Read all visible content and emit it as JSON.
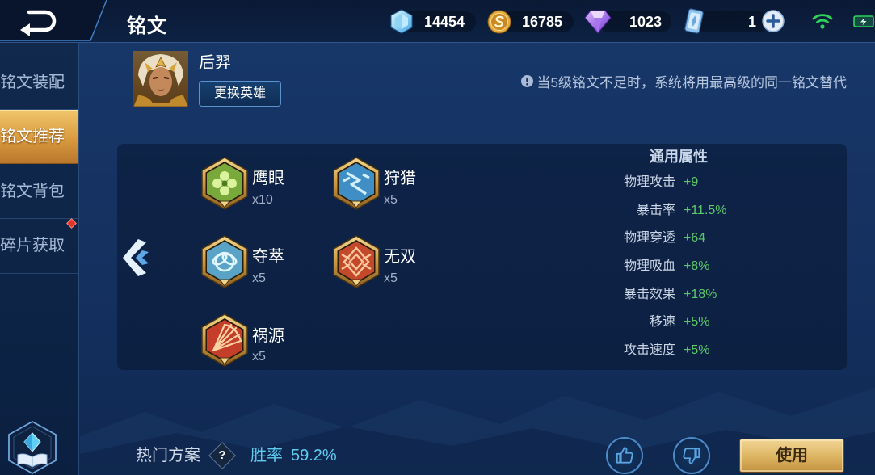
{
  "header": {
    "title": "铭文",
    "back_icon": "back-arrow-icon"
  },
  "currencies": [
    {
      "icon": "diamond-icon",
      "value": "14454"
    },
    {
      "icon": "gold-coin-icon",
      "value": "16785"
    },
    {
      "icon": "purple-gem-icon",
      "value": "1023"
    },
    {
      "icon": "ticket-card-icon",
      "value": "1",
      "add_icon": "plus-icon"
    }
  ],
  "status": {
    "wifi_icon": "wifi-icon",
    "battery_icon": "battery-icon"
  },
  "sidebar": {
    "items": [
      {
        "label": "铭文装配",
        "selected": false
      },
      {
        "label": "铭文推荐",
        "selected": true
      },
      {
        "label": "铭文背包",
        "selected": false
      },
      {
        "label": "碎片获取",
        "selected": false,
        "badge": true
      }
    ],
    "bottom_icon": "inscription-book-icon"
  },
  "hero": {
    "name": "后羿",
    "change_button": "更换英雄",
    "avatar_icon": "hero-portrait-icon"
  },
  "notice": {
    "icon": "info-icon",
    "text": "当5级铭文不足时，系统将用最高级的同一铭文替代"
  },
  "inscriptions": [
    {
      "name": "鹰眼",
      "count": "x10",
      "color": "#79a93a",
      "accent": "#dbf39c"
    },
    {
      "name": "狩猎",
      "count": "x5",
      "color": "#3f8fc6",
      "accent": "#d4f0ff"
    },
    {
      "name": "夺萃",
      "count": "x5",
      "color": "#58a3c6",
      "accent": "#e2f6ff"
    },
    {
      "name": "无双",
      "count": "x5",
      "color": "#c4492b",
      "accent": "#ffc79c"
    },
    {
      "name": "祸源",
      "count": "x5",
      "color": "#c53e2a",
      "accent": "#ffd2a2"
    }
  ],
  "attributes": {
    "title": "通用属性",
    "items": [
      {
        "label": "物理攻击",
        "value": "+9"
      },
      {
        "label": "暴击率",
        "value": "+11.5%"
      },
      {
        "label": "物理穿透",
        "value": "+64"
      },
      {
        "label": "物理吸血",
        "value": "+8%"
      },
      {
        "label": "暴击效果",
        "value": "+18%"
      },
      {
        "label": "移速",
        "value": "+5%"
      },
      {
        "label": "攻击速度",
        "value": "+5%"
      }
    ]
  },
  "footer": {
    "hot_label": "热门方案",
    "help": "?",
    "winrate_label": "胜率",
    "winrate_value": "59.2%",
    "like_icon": "thumbs-up-icon",
    "dislike_icon": "thumbs-down-icon",
    "use_button": "使用"
  },
  "colors": {
    "accent_gold": "#d9ad5a",
    "attribute_value": "#5cc96a",
    "winrate": "#5ecbef",
    "selected_tab": "#e2a84d",
    "status_green": "#2fd35a"
  }
}
